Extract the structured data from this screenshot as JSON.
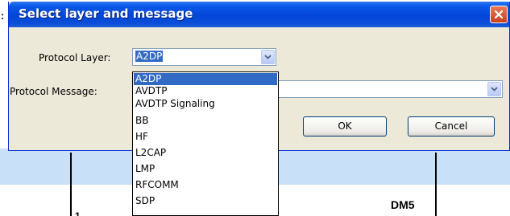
{
  "background": {
    "colon_fragment": ":",
    "label_dm5": "DM5",
    "label_one": "1"
  },
  "dialog": {
    "title": "Select layer and message",
    "close_icon": "close-icon",
    "protocol_layer_label": "Protocol Layer:",
    "protocol_layer_value": "A2DP",
    "protocol_message_label": "Protocol Message:",
    "protocol_message_value": "",
    "ok_label": "OK",
    "cancel_label": "Cancel"
  },
  "dropdown": {
    "options": [
      "A2DP",
      "AVDTP",
      "AVDTP Signaling",
      "BB",
      "HF",
      "L2CAP",
      "LMP",
      "RFCOMM",
      "SDP"
    ],
    "highlighted": "A2DP"
  },
  "colors": {
    "titlebar": "#0446d8",
    "selection": "#316ac5",
    "dialog_bg": "#ece9d8",
    "close_button": "#d8542c"
  }
}
